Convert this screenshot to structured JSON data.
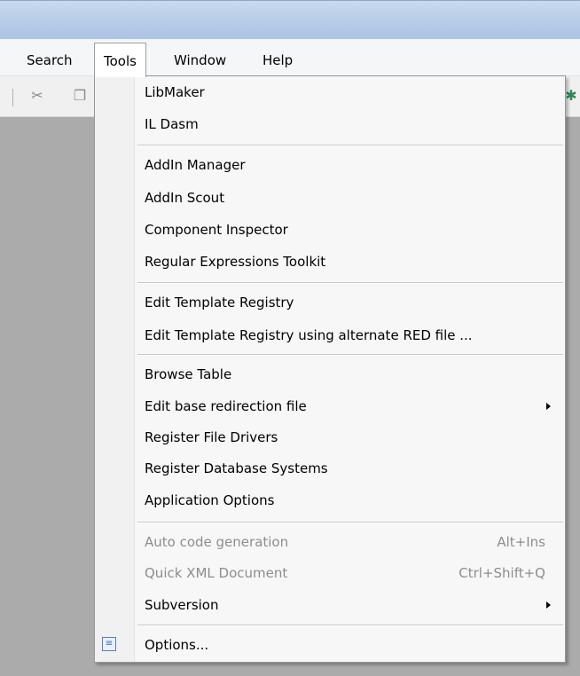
{
  "menubar": {
    "items": [
      {
        "label": "Search"
      },
      {
        "label": "Tools",
        "open": true
      },
      {
        "label": "Window"
      },
      {
        "label": "Help"
      }
    ]
  },
  "toolbar": {
    "icons": [
      "scissors-icon",
      "copy-icon",
      "run-icon"
    ]
  },
  "tools_menu": {
    "groups": [
      {
        "items": [
          {
            "label": "LibMaker"
          },
          {
            "label": "IL Dasm"
          }
        ]
      },
      {
        "items": [
          {
            "label": "AddIn Manager"
          },
          {
            "label": "AddIn Scout"
          },
          {
            "label": "Component Inspector"
          },
          {
            "label": "Regular Expressions Toolkit"
          }
        ]
      },
      {
        "items": [
          {
            "label": "Edit Template Registry"
          },
          {
            "label": "Edit Template Registry using alternate RED file ..."
          }
        ]
      },
      {
        "items": [
          {
            "label": "Browse Table"
          },
          {
            "label": "Edit base redirection file",
            "submenu": true
          },
          {
            "label": "Register File Drivers"
          },
          {
            "label": "Register Database Systems"
          },
          {
            "label": "Application Options"
          }
        ]
      },
      {
        "items": [
          {
            "label": "Auto code generation",
            "shortcut": "Alt+Ins",
            "disabled": true
          },
          {
            "label": "Quick XML Document",
            "shortcut": "Ctrl+Shift+Q",
            "disabled": true
          },
          {
            "label": "Subversion",
            "submenu": true
          }
        ]
      },
      {
        "items": [
          {
            "label": "Options...",
            "icon": "options-icon"
          }
        ]
      }
    ]
  }
}
